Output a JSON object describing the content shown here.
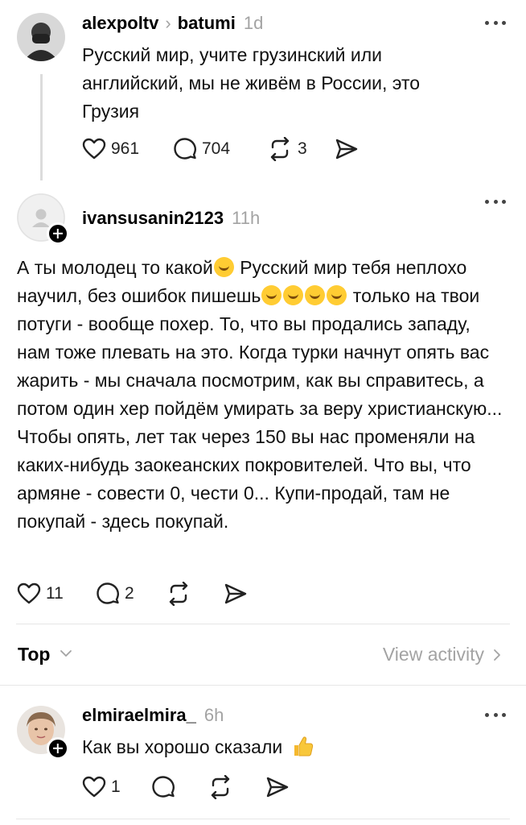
{
  "posts": [
    {
      "username": "alexpoltv",
      "topic": "batumi",
      "time": "1d",
      "text": "Русский мир, учите грузинский или английский, мы не живём в России, это Грузия",
      "likes": "961",
      "replies": "704",
      "reposts": "3"
    },
    {
      "username": "ivansusanin2123",
      "time": "11h",
      "text_part1": "А ты молодец то какой",
      "text_part2": " Русский мир тебя неплохо научил, без ошибок пишешь",
      "text_part3": " только на твои потуги - вообще похер. То, что вы продались западу, нам тоже плевать на это. Когда турки начнут опять вас жарить - мы сначала посмотрим, как вы справитесь, а потом один хер пойдём умирать за веру христианскую... Чтобы опять, лет так через 150 вы нас променяли на каких-нибудь заокеанских покровителей. Что вы, что армяне - совести 0, чести 0... Купи-продай, там не покупай - здесь покупай.",
      "likes": "11",
      "replies": "2"
    },
    {
      "username": "elmiraelmira_",
      "time": "6h",
      "text": "Как вы хорошо сказали",
      "likes": "1"
    }
  ],
  "sortbar": {
    "sort_label": "Top",
    "view_activity": "View activity"
  },
  "icons": {
    "like": "heart-icon",
    "reply": "comment-icon",
    "repost": "repost-icon",
    "share": "send-icon",
    "more": "ellipsis-icon"
  }
}
